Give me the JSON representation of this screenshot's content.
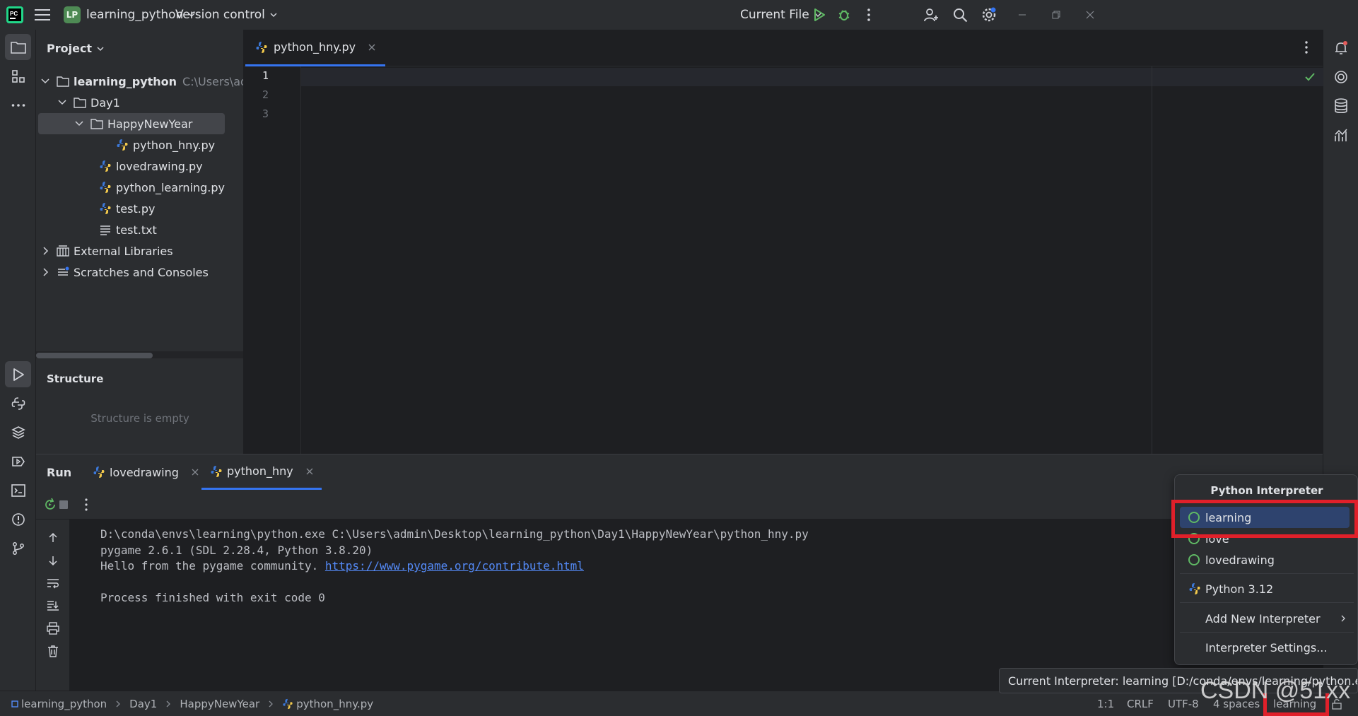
{
  "titlebar": {
    "project_badge": "LP",
    "project_name": "learning_python",
    "vcs_label": "Version control",
    "run_config": "Current File"
  },
  "project_panel": {
    "title": "Project",
    "root": {
      "name": "learning_python",
      "path_hint": "C:\\Users\\adm"
    },
    "items": [
      {
        "label": "Day1"
      },
      {
        "label": "HappyNewYear"
      },
      {
        "label": "python_hny.py"
      },
      {
        "label": "lovedrawing.py"
      },
      {
        "label": "python_learning.py"
      },
      {
        "label": "test.py"
      },
      {
        "label": "test.txt"
      },
      {
        "label": "External Libraries"
      },
      {
        "label": "Scratches and Consoles"
      }
    ]
  },
  "structure": {
    "title": "Structure",
    "empty_text": "Structure is empty"
  },
  "editor": {
    "tab_label": "python_hny.py",
    "line_numbers": [
      "1",
      "2",
      "3"
    ]
  },
  "run_panel": {
    "title": "Run",
    "tabs": [
      {
        "label": "lovedrawing"
      },
      {
        "label": "python_hny"
      }
    ],
    "console": {
      "line1": "D:\\conda\\envs\\learning\\python.exe C:\\Users\\admin\\Desktop\\learning_python\\Day1\\HappyNewYear\\python_hny.py",
      "line2": "pygame 2.6.1 (SDL 2.28.4, Python 3.8.20)",
      "line3_prefix": "Hello from the pygame community. ",
      "line3_link": "https://www.pygame.org/contribute.html",
      "line5": "Process finished with exit code 0"
    }
  },
  "interpreter_popup": {
    "title": "Python Interpreter",
    "envs": [
      {
        "label": "learning"
      },
      {
        "label": "love"
      },
      {
        "label": "lovedrawing"
      }
    ],
    "system": "Python 3.12",
    "add_new": "Add New Interpreter",
    "settings": "Interpreter Settings..."
  },
  "tooltip": "Current Interpreter: learning [D:/conda/envs/learning/python.exe]",
  "statusbar": {
    "breadcrumb": [
      "learning_python",
      "Day1",
      "HappyNewYear",
      "python_hny.py"
    ],
    "position": "1:1",
    "line_sep": "CRLF",
    "encoding": "UTF-8",
    "indent": "4 spaces",
    "interpreter": "learning"
  },
  "watermark": "CSDN @51xx",
  "colors": {
    "accent": "#3574f0",
    "panel_bg": "#2b2d30",
    "editor_bg": "#1e1f22",
    "highlight_red": "#e0202a",
    "run_green": "#5fb864"
  }
}
